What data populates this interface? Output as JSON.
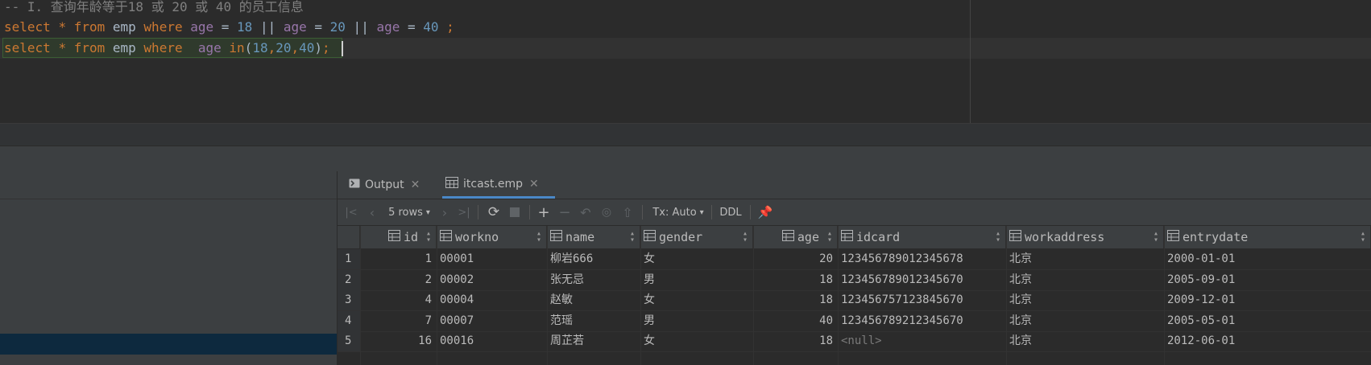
{
  "editor": {
    "comment": "-- I. 查询年龄等于18 或 20 或 40 的员工信息",
    "line1": [
      {
        "t": "select",
        "c": "kw"
      },
      {
        "t": " ",
        "c": "id"
      },
      {
        "t": "*",
        "c": "kw"
      },
      {
        "t": " ",
        "c": "id"
      },
      {
        "t": "from",
        "c": "kw"
      },
      {
        "t": " emp ",
        "c": "id"
      },
      {
        "t": "where",
        "c": "kw"
      },
      {
        "t": " ",
        "c": "id"
      },
      {
        "t": "age",
        "c": "col"
      },
      {
        "t": " = ",
        "c": "op"
      },
      {
        "t": "18",
        "c": "num"
      },
      {
        "t": " || ",
        "c": "op"
      },
      {
        "t": "age",
        "c": "col"
      },
      {
        "t": " = ",
        "c": "op"
      },
      {
        "t": "20",
        "c": "num"
      },
      {
        "t": " || ",
        "c": "op"
      },
      {
        "t": "age",
        "c": "col"
      },
      {
        "t": " = ",
        "c": "op"
      },
      {
        "t": "40",
        "c": "num"
      },
      {
        "t": " ",
        "c": "id"
      },
      {
        "t": ";",
        "c": "kw"
      }
    ],
    "line2": [
      {
        "t": "select",
        "c": "kw"
      },
      {
        "t": " ",
        "c": "id"
      },
      {
        "t": "*",
        "c": "kw"
      },
      {
        "t": " ",
        "c": "id"
      },
      {
        "t": "from",
        "c": "kw"
      },
      {
        "t": " emp ",
        "c": "id"
      },
      {
        "t": "where",
        "c": "kw"
      },
      {
        "t": "  ",
        "c": "id"
      },
      {
        "t": "age",
        "c": "col"
      },
      {
        "t": " ",
        "c": "id"
      },
      {
        "t": "in",
        "c": "kw"
      },
      {
        "t": "(",
        "c": "op"
      },
      {
        "t": "18",
        "c": "num"
      },
      {
        "t": ",",
        "c": "kw"
      },
      {
        "t": "20",
        "c": "num"
      },
      {
        "t": ",",
        "c": "kw"
      },
      {
        "t": "40",
        "c": "num"
      },
      {
        "t": ")",
        "c": "op"
      },
      {
        "t": ";",
        "c": "kw"
      }
    ]
  },
  "tabs": {
    "output_label": "Output",
    "output_icon": "console-icon",
    "result_label": "itcast.emp",
    "result_icon": "table-icon"
  },
  "toolbar": {
    "rows_label": "5 rows",
    "tx_label": "Tx: Auto",
    "ddl_label": "DDL"
  },
  "columns": [
    {
      "key": "id",
      "label": "id",
      "align": "right"
    },
    {
      "key": "workno",
      "label": "workno",
      "align": "left"
    },
    {
      "key": "name",
      "label": "name",
      "align": "left"
    },
    {
      "key": "gender",
      "label": "gender",
      "align": "left"
    },
    {
      "key": "age",
      "label": "age",
      "align": "right"
    },
    {
      "key": "idcard",
      "label": "idcard",
      "align": "left"
    },
    {
      "key": "workaddress",
      "label": "workaddress",
      "align": "left"
    },
    {
      "key": "entrydate",
      "label": "entrydate",
      "align": "left"
    }
  ],
  "rows": [
    {
      "num": "1",
      "id": "1",
      "workno": "00001",
      "name": "柳岩666",
      "gender": "女",
      "age": "20",
      "idcard": "123456789012345678",
      "workaddress": "北京",
      "entrydate": "2000-01-01"
    },
    {
      "num": "2",
      "id": "2",
      "workno": "00002",
      "name": "张无忌",
      "gender": "男",
      "age": "18",
      "idcard": "123456789012345670",
      "workaddress": "北京",
      "entrydate": "2005-09-01"
    },
    {
      "num": "3",
      "id": "4",
      "workno": "00004",
      "name": "赵敏",
      "gender": "女",
      "age": "18",
      "idcard": "123456757123845670",
      "workaddress": "北京",
      "entrydate": "2009-12-01"
    },
    {
      "num": "4",
      "id": "7",
      "workno": "00007",
      "name": "范瑶",
      "gender": "男",
      "age": "40",
      "idcard": "123456789212345670",
      "workaddress": "北京",
      "entrydate": "2005-05-01"
    },
    {
      "num": "5",
      "id": "16",
      "workno": "00016",
      "name": "周芷若",
      "gender": "女",
      "age": "18",
      "idcard": "<null>",
      "workaddress": "北京",
      "entrydate": "2012-06-01"
    }
  ],
  "colors": {
    "keyword": "#cc7832",
    "identifier": "#a9b7c6",
    "column": "#9876aa",
    "number": "#6897bb",
    "accent": "#4a88c7"
  }
}
